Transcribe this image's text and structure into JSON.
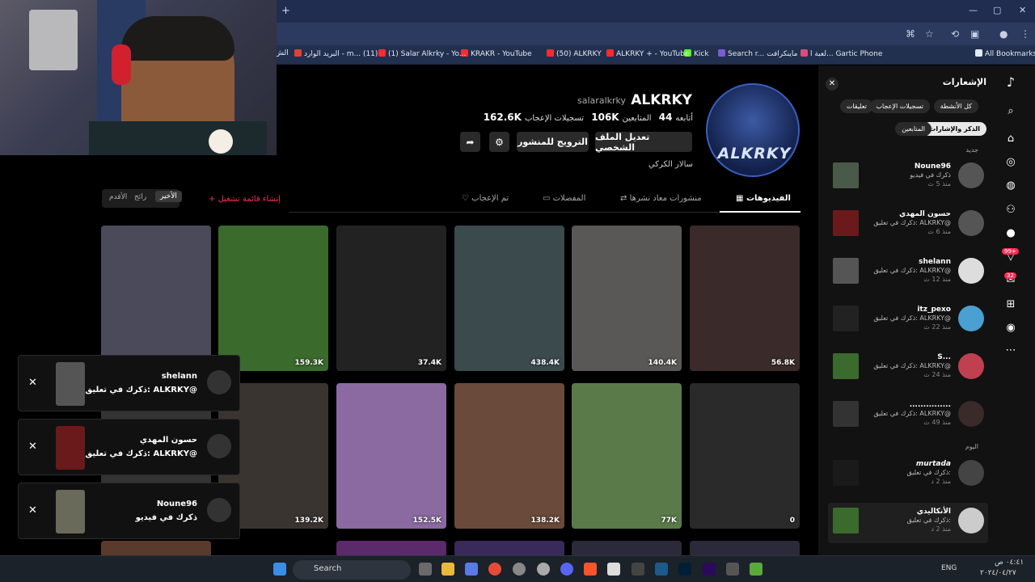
{
  "browser": {
    "bookmarks": [
      {
        "label": "All Bookmarks",
        "color": "#e4e8f3"
      },
      {
        "label": "لعبة ا... Gartic Phone",
        "color": "#d94d7a"
      },
      {
        "label": "Search r... ماينكرافت",
        "color": "#7a5bd6"
      },
      {
        "label": "Kick",
        "color": "#53fc18"
      },
      {
        "label": "ALKRKY + - YouTube",
        "color": "#ff2b2b"
      },
      {
        "label": "(50) ALKRKY",
        "color": "#ff2b2b"
      },
      {
        "label": "KRAKR - YouTube",
        "color": "#ff2b2b"
      },
      {
        "label": "(1) Salar Alkrky - Yo...",
        "color": "#ff2b2b"
      },
      {
        "label": "البريد الوارد - m... (11)",
        "color": "#e34133"
      },
      {
        "label": "الش",
        "color": "#cccccc"
      }
    ]
  },
  "profile": {
    "display_name": "ALKRKY",
    "username": "salaralkrky",
    "logo_text": "ALKRKY",
    "following_label": "أتابعه",
    "following_count": "44",
    "followers_label": "المتابعين",
    "followers_count": "106K",
    "likes_label": "تسجيلات الإعجاب",
    "likes_count": "162.6K",
    "edit_label": "تعديل الملف الشخصي",
    "promote_label": "الترويج للمنشور",
    "bio": "سالار الكركي"
  },
  "tabs": [
    {
      "label": "الفيديوهات"
    },
    {
      "label": "منشورات معاد نشرها"
    },
    {
      "label": "المفضلات"
    },
    {
      "label": "تم الإعجاب"
    }
  ],
  "playlist_label": "إنشاء قائمة تشغيل",
  "sort": {
    "latest": "الأخير",
    "popular": "رائج",
    "oldest": "الأقدم"
  },
  "videos_row1": [
    {
      "count": "56.8K",
      "bg": "#3b2a2a"
    },
    {
      "count": "140.4K",
      "bg": "#5a5856"
    },
    {
      "count": "438.4K",
      "bg": "#3a4a4d"
    },
    {
      "count": "37.4K",
      "bg": "#222222"
    },
    {
      "count": "159.3K",
      "bg": "#3b6a2d"
    },
    {
      "count": "",
      "bg": "#4a4a5a"
    }
  ],
  "videos_row2": [
    {
      "count": "0",
      "bg": "#2a2a2a"
    },
    {
      "count": "77K",
      "bg": "#5a7a4a"
    },
    {
      "count": "138.2K",
      "bg": "#6a4a3a"
    },
    {
      "count": "152.5K",
      "bg": "#8a6aa0"
    },
    {
      "count": "139.2K",
      "bg": "#3a3430"
    },
    {
      "count": "",
      "bg": "#333333"
    }
  ],
  "popups": [
    {
      "name": "shelann",
      "text": "ذكرك في تعليق: ALKRKY@"
    },
    {
      "name": "حسون المهدي",
      "text": "ذكرك في تعليق: ALKRKY@"
    },
    {
      "name": "Noune96",
      "text": "ذكرك في فيديو"
    }
  ],
  "notifications": {
    "title": "الإشعارات",
    "chips": [
      "كل الأنشطة",
      "تسجيلات الإعجاب",
      "تعليقات",
      "الذكر والإشارات",
      "المتابعين"
    ],
    "section_new": "جديد",
    "section_today": "اليوم",
    "items": [
      {
        "name": "Noune96",
        "text": "ذكرك في فيديو",
        "time": "منذ 5 ث"
      },
      {
        "name": "حسون المهدي",
        "text": "ذكرك في تعليق: ALKRKY@",
        "time": "منذ 6 ث"
      },
      {
        "name": "shelann",
        "text": "ذكرك في تعليق: ALKRKY@",
        "time": "منذ 12 ث"
      },
      {
        "name": "itz_pexo",
        "text": "ذكرك في تعليق: ALKRKY@",
        "time": "منذ 22 ث"
      },
      {
        "name": "S...",
        "text": "ذكرك في تعليق: ALKRKY@",
        "time": "منذ 24 ث"
      },
      {
        "name": "...............",
        "text": "ذكرك في تعليق: ALKRKY@",
        "time": "منذ 49 ث"
      },
      {
        "name": "murtada",
        "text": "ذكرك في تعليق:",
        "time": "منذ 2 د"
      },
      {
        "name": "الأنكاليدي",
        "text": "ذكرك في تعليق:",
        "time": "منذ 2 د"
      }
    ]
  },
  "rail_badges": {
    "inbox": "99+",
    "messages": "32"
  },
  "taskbar": {
    "search": "Search",
    "lang": "ENG",
    "time": "٠٤:٤١ ص",
    "date": "٢٠٢٤/٠٤/٢٧"
  }
}
